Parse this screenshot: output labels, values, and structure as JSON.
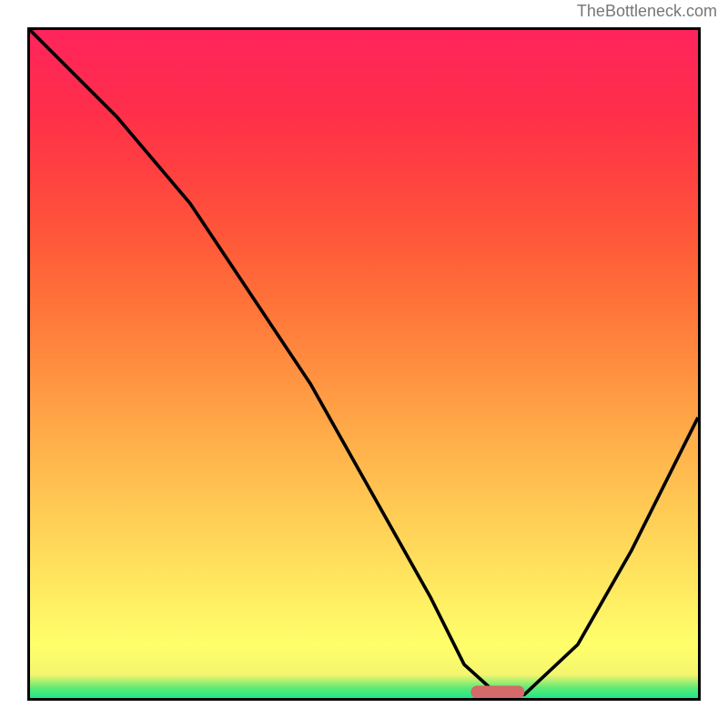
{
  "attribution": "TheBottleneck.com",
  "plot": {
    "show_ticks": false,
    "show_axis_labels": false
  },
  "chart_data": {
    "type": "line",
    "title": "",
    "xlabel": "",
    "ylabel": "",
    "xlim": [
      0,
      100
    ],
    "ylim": [
      0,
      100
    ],
    "grid": false,
    "legend": false,
    "color_scheme": "red-yellow-green vertical gradient (green=low, red=high)",
    "series": [
      {
        "name": "curve",
        "x": [
          0,
          13,
          24,
          42,
          60,
          65,
          70,
          74,
          82,
          90,
          100
        ],
        "y": [
          100,
          87,
          74,
          47,
          15,
          5,
          0.5,
          0.5,
          8,
          22,
          42
        ]
      }
    ],
    "marker": {
      "x_range": [
        66,
        74
      ],
      "y": 0.5,
      "shape": "pill",
      "color": "#d46a6a"
    }
  }
}
